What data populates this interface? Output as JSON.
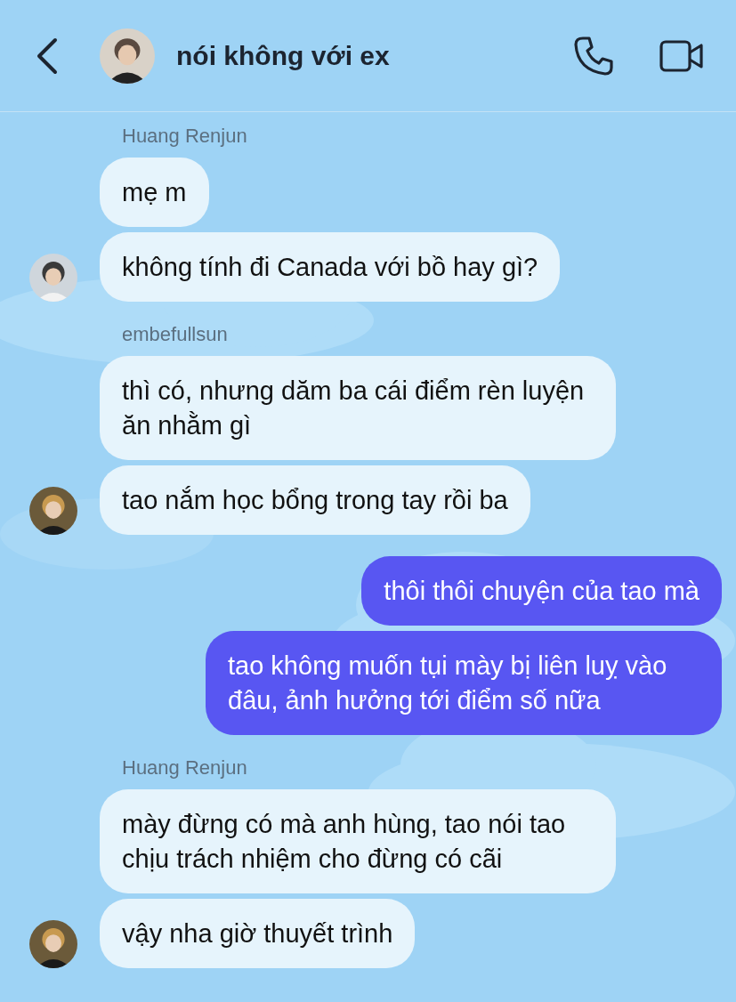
{
  "header": {
    "title": "nói không với ex"
  },
  "groups": [
    {
      "sender": "Huang Renjun",
      "outgoing": false,
      "messages": [
        "mẹ m",
        "không tính đi Canada với bồ hay gì?"
      ]
    },
    {
      "sender": "embefullsun",
      "outgoing": false,
      "messages": [
        "thì có, nhưng dăm ba cái điểm rèn luyện ăn nhằm gì",
        "tao nắm học bổng trong tay rồi ba"
      ]
    },
    {
      "outgoing": true,
      "messages": [
        "thôi thôi chuyện của tao mà",
        "tao không muốn tụi mày bị liên luỵ vào đâu, ảnh hưởng tới điểm số nữa"
      ]
    },
    {
      "sender": "Huang Renjun",
      "outgoing": false,
      "messages": [
        "mày đừng có mà anh hùng, tao nói tao chịu trách nhiệm cho đừng có cãi",
        "vậy nha giờ thuyết trình"
      ]
    }
  ]
}
